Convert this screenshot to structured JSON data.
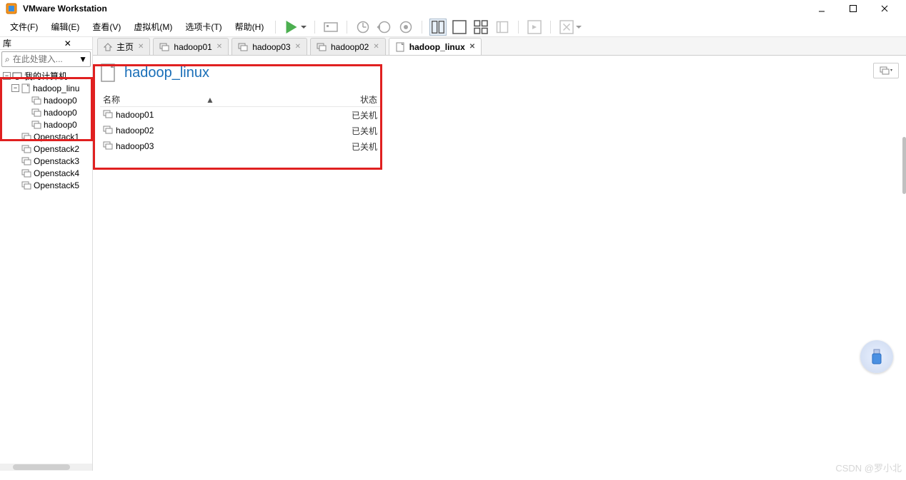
{
  "app": {
    "title": "VMware Workstation"
  },
  "menus": [
    {
      "label": "文件(F)"
    },
    {
      "label": "编辑(E)"
    },
    {
      "label": "查看(V)"
    },
    {
      "label": "虚拟机(M)"
    },
    {
      "label": "选项卡(T)"
    },
    {
      "label": "帮助(H)"
    }
  ],
  "sidebar": {
    "title": "库",
    "search_placeholder": "在此处键入...",
    "tree": {
      "root": "我的计算机",
      "folder": "hadoop_linu",
      "folder_children": [
        "hadoop0",
        "hadoop0",
        "hadoop0"
      ],
      "others": [
        "Openstack1",
        "Openstack2",
        "Openstack3",
        "Openstack4",
        "Openstack5"
      ]
    }
  },
  "tabs": [
    {
      "icon": "home",
      "label": "主页"
    },
    {
      "icon": "vm",
      "label": "hadoop01"
    },
    {
      "icon": "vm",
      "label": "hadoop03"
    },
    {
      "icon": "vm",
      "label": "hadoop02"
    },
    {
      "icon": "folder",
      "label": "hadoop_linux",
      "active": true
    }
  ],
  "content": {
    "title": "hadoop_linux",
    "columns": {
      "name": "名称",
      "status": "状态"
    },
    "rows": [
      {
        "name": "hadoop01",
        "status": "已关机"
      },
      {
        "name": "hadoop02",
        "status": "已关机"
      },
      {
        "name": "hadoop03",
        "status": "已关机"
      }
    ]
  },
  "watermark": "CSDN @罗小北"
}
